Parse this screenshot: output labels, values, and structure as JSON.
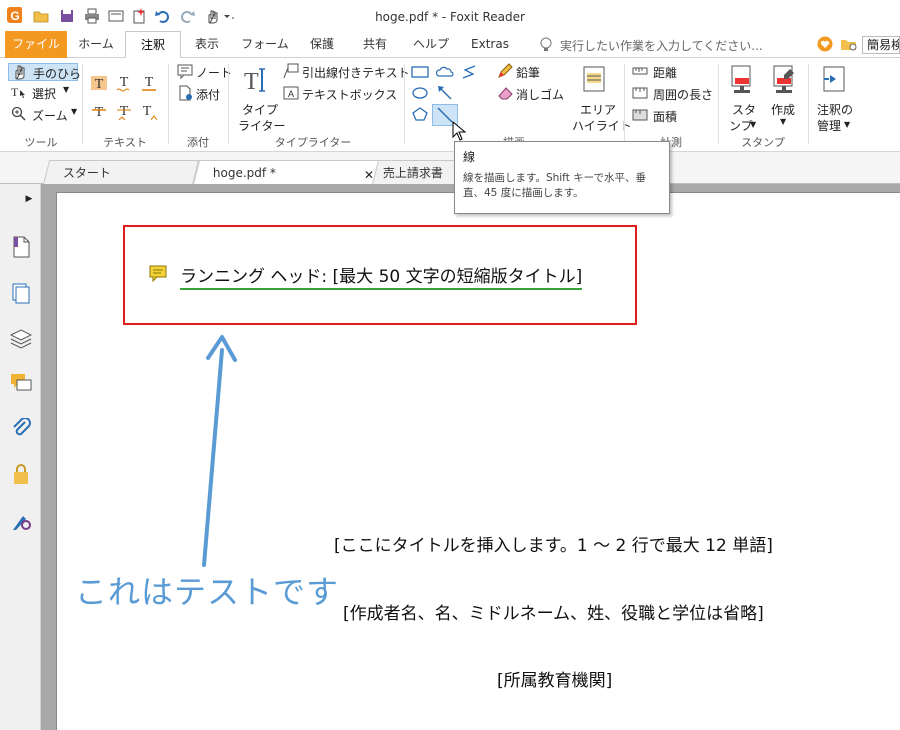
{
  "window": {
    "title": "hoge.pdf * - Foxit Reader"
  },
  "ribbon_tabs": [
    {
      "label": "ファイル"
    },
    {
      "label": "ホーム"
    },
    {
      "label": "注釈"
    },
    {
      "label": "表示"
    },
    {
      "label": "フォーム"
    },
    {
      "label": "保護"
    },
    {
      "label": "共有"
    },
    {
      "label": "ヘルプ"
    },
    {
      "label": "Extras"
    }
  ],
  "tell_me": {
    "placeholder": "実行したい作業を入力してください..."
  },
  "account_label": "簡易検",
  "ribbon": {
    "tools": {
      "hand": "手のひら",
      "select": "選択",
      "zoom": "ズーム",
      "group": "ツール"
    },
    "text": {
      "group": "テキスト"
    },
    "attach": {
      "note": "ノート",
      "file": "添付",
      "group": "添付"
    },
    "typewriter": {
      "typewriter_line1": "タイプ",
      "typewriter_line2": "ライター",
      "callout": "引出線付きテキスト",
      "textbox": "テキストボックス",
      "group": "タイプライター"
    },
    "drawing": {
      "pencil": "鉛筆",
      "eraser": "消しゴム",
      "area_hl_line1": "エリア",
      "area_hl_line2": "ハイライト",
      "group": "描画"
    },
    "measure": {
      "distance": "距離",
      "perimeter": "周囲の長さ",
      "area": "面積",
      "group": "計測"
    },
    "stamp": {
      "stamp_line1": "スタ",
      "stamp_line2": "ンプ",
      "create": "作成",
      "group": "スタンプ"
    },
    "manage": {
      "line1": "注釈の",
      "line2": "管理"
    }
  },
  "doc_tabs": [
    {
      "label": "スタート"
    },
    {
      "label": "hoge.pdf *"
    },
    {
      "label": "売上請求書"
    }
  ],
  "tooltip": {
    "title": "線",
    "body": "線を描画します。Shift キーで水平、垂直、45 度に描画します。"
  },
  "document": {
    "running_head": "ランニング ヘッド: [最大 50 文字の短縮版タイトル]",
    "title_placeholder": "[ここにタイトルを挿入します。1 〜 2 行で最大 12 単語]",
    "author_placeholder": "[作成者名、名、ミドルネーム、姓、役職と学位は省略]",
    "institution_placeholder": "[所属教育機関]",
    "annotation_text": "これはテストです"
  },
  "colors": {
    "file_tab": "#f39821",
    "red_box": "#e11c1c",
    "annotation_blue": "#5b9bd5",
    "underline_green": "#3aa33a"
  }
}
